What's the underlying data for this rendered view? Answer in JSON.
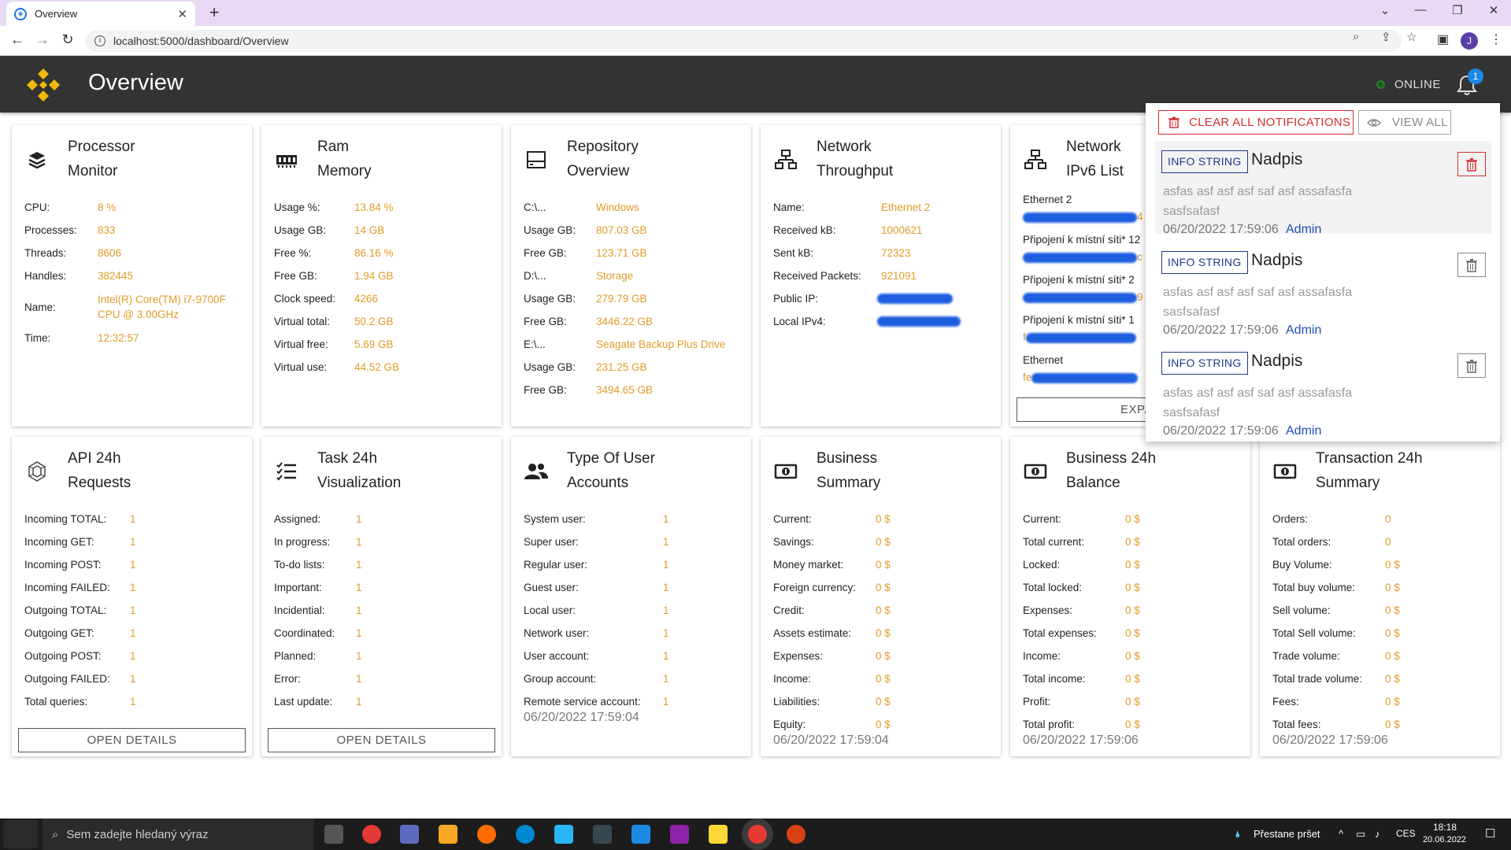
{
  "browser": {
    "tab_title": "Overview",
    "url": "localhost:5000/dashboard/Overview",
    "profile_initial": "J"
  },
  "header": {
    "title": "Overview",
    "status": "ONLINE",
    "notification_count": "1"
  },
  "cards_top": [
    {
      "title1": "Processor",
      "title2": "Monitor",
      "icon": "layers-icon",
      "rows": [
        {
          "k": "CPU:",
          "v": "8 %"
        },
        {
          "k": "Processes:",
          "v": "833"
        },
        {
          "k": "Threads:",
          "v": "8606"
        },
        {
          "k": "Handles:",
          "v": "382445"
        },
        {
          "k": "Name:",
          "v": "Intel(R) Core(TM) i7-9700F CPU @ 3.00GHz"
        },
        {
          "k": "Time:",
          "v": "12:32:57"
        }
      ]
    },
    {
      "title1": "Ram",
      "title2": "Memory",
      "icon": "memory-icon",
      "rows": [
        {
          "k": "Usage %:",
          "v": "13.84 %"
        },
        {
          "k": "Usage GB:",
          "v": "14 GB"
        },
        {
          "k": "Free %:",
          "v": "86.16 %"
        },
        {
          "k": "Free GB:",
          "v": "1.94 GB"
        },
        {
          "k": "Clock speed:",
          "v": "4266"
        },
        {
          "k": "Virtual total:",
          "v": "50.2 GB"
        },
        {
          "k": "Virtual free:",
          "v": "5.69 GB"
        },
        {
          "k": "Virtual use:",
          "v": "44.52 GB"
        }
      ]
    },
    {
      "title1": "Repository",
      "title2": "Overview",
      "icon": "storage-icon",
      "rows": [
        {
          "k": "C:\\...",
          "v": "Windows"
        },
        {
          "k": "Usage GB:",
          "v": "807.03 GB"
        },
        {
          "k": "Free GB:",
          "v": "123.71 GB"
        },
        {
          "k": "D:\\...",
          "v": "Storage"
        },
        {
          "k": "Usage GB:",
          "v": "279.79 GB"
        },
        {
          "k": "Free GB:",
          "v": "3446.22 GB"
        },
        {
          "k": "E:\\...",
          "v": "Seagate Backup Plus Drive"
        },
        {
          "k": "Usage GB:",
          "v": "231.25 GB"
        },
        {
          "k": "Free GB:",
          "v": "3494.65 GB"
        }
      ]
    },
    {
      "title1": "Network",
      "title2": "Throughput",
      "icon": "network-icon",
      "rows": [
        {
          "k": "Name:",
          "v": "Ethernet 2"
        },
        {
          "k": "Received kB:",
          "v": "1000621"
        },
        {
          "k": "Sent kB:",
          "v": "72323"
        },
        {
          "k": "Received Packets:",
          "v": "921091"
        },
        {
          "k": "Public IP:",
          "v": ""
        },
        {
          "k": "Local IPv4:",
          "v": ""
        }
      ]
    },
    {
      "title1": "Network",
      "title2": "IPv6 List",
      "icon": "network-icon",
      "entries": [
        {
          "name": "Ethernet 2",
          "tail": "4"
        },
        {
          "name": "Připojení k místní síti* 12",
          "tail": "c"
        },
        {
          "name": "Připojení k místní síti* 2",
          "tail": "9"
        },
        {
          "name": "Připojení k místní síti* 1",
          "tail": "f"
        },
        {
          "name": "Ethernet",
          "tail": "fe"
        }
      ],
      "button": "EXPAND I"
    }
  ],
  "cards_bottom": [
    {
      "title1": "API 24h",
      "title2": "Requests",
      "icon": "api-icon",
      "rows": [
        {
          "k": "Incoming TOTAL:",
          "v": "1"
        },
        {
          "k": "Incoming GET:",
          "v": "1"
        },
        {
          "k": "Incoming POST:",
          "v": "1"
        },
        {
          "k": "Incoming FAILED:",
          "v": "1"
        },
        {
          "k": "Outgoing TOTAL:",
          "v": "1"
        },
        {
          "k": "Outgoing GET:",
          "v": "1"
        },
        {
          "k": "Outgoing POST:",
          "v": "1"
        },
        {
          "k": "Outgoing FAILED:",
          "v": "1"
        },
        {
          "k": "Total queries:",
          "v": "1"
        }
      ],
      "button": "OPEN DETAILS"
    },
    {
      "title1": "Task 24h",
      "title2": "Visualization",
      "icon": "checklist-icon",
      "rows": [
        {
          "k": "Assigned:",
          "v": "1"
        },
        {
          "k": "In progress:",
          "v": "1"
        },
        {
          "k": "To-do lists:",
          "v": "1"
        },
        {
          "k": "Important:",
          "v": "1"
        },
        {
          "k": "Incidential:",
          "v": "1"
        },
        {
          "k": "Coordinated:",
          "v": "1"
        },
        {
          "k": "Planned:",
          "v": "1"
        },
        {
          "k": "Error:",
          "v": "1"
        },
        {
          "k": "Last update:",
          "v": "1"
        }
      ],
      "button": "OPEN DETAILS"
    },
    {
      "title1": "Type Of User",
      "title2": "Accounts",
      "icon": "users-icon",
      "rows": [
        {
          "k": "System user:",
          "v": "1"
        },
        {
          "k": "Super user:",
          "v": "1"
        },
        {
          "k": "Regular user:",
          "v": "1"
        },
        {
          "k": "Guest user:",
          "v": "1"
        },
        {
          "k": "Local user:",
          "v": "1"
        },
        {
          "k": "Network user:",
          "v": "1"
        },
        {
          "k": "User account:",
          "v": "1"
        },
        {
          "k": "Group account:",
          "v": "1"
        },
        {
          "k": "Remote service account:",
          "v": "1"
        }
      ],
      "timestamp": "06/20/2022 17:59:04"
    },
    {
      "title1": "Business",
      "title2": "Summary",
      "icon": "money-icon",
      "rows": [
        {
          "k": "Current:",
          "v": "0 $"
        },
        {
          "k": "Savings:",
          "v": "0 $"
        },
        {
          "k": "Money market:",
          "v": "0 $"
        },
        {
          "k": "Foreign currency:",
          "v": "0 $"
        },
        {
          "k": "Credit:",
          "v": "0 $"
        },
        {
          "k": "Assets estimate:",
          "v": "0 $"
        },
        {
          "k": "Expenses:",
          "v": "0 $"
        },
        {
          "k": "Income:",
          "v": "0 $"
        },
        {
          "k": "Liabilities:",
          "v": "0 $"
        },
        {
          "k": "Equity:",
          "v": "0 $"
        }
      ],
      "timestamp": "06/20/2022 17:59:04"
    },
    {
      "title1": "Business 24h",
      "title2": "Balance",
      "icon": "money-icon",
      "rows": [
        {
          "k": "Current:",
          "v": "0 $"
        },
        {
          "k": "Total current:",
          "v": "0 $"
        },
        {
          "k": "Locked:",
          "v": "0 $"
        },
        {
          "k": "Total locked:",
          "v": "0 $"
        },
        {
          "k": "Expenses:",
          "v": "0 $"
        },
        {
          "k": "Total expenses:",
          "v": "0 $"
        },
        {
          "k": "Income:",
          "v": "0 $"
        },
        {
          "k": "Total income:",
          "v": "0 $"
        },
        {
          "k": "Profit:",
          "v": "0 $"
        },
        {
          "k": "Total profit:",
          "v": "0 $"
        }
      ],
      "timestamp": "06/20/2022 17:59:06"
    },
    {
      "title1": "Transaction 24h",
      "title2": "Summary",
      "icon": "money-icon",
      "rows": [
        {
          "k": "Orders:",
          "v": "0"
        },
        {
          "k": "Total orders:",
          "v": "0"
        },
        {
          "k": "Buy Volume:",
          "v": "0 $"
        },
        {
          "k": "Total buy volume:",
          "v": "0 $"
        },
        {
          "k": "Sell volume:",
          "v": "0 $"
        },
        {
          "k": "Total Sell volume:",
          "v": "0 $"
        },
        {
          "k": "Trade volume:",
          "v": "0 $"
        },
        {
          "k": "Total trade volume:",
          "v": "0 $"
        },
        {
          "k": "Fees:",
          "v": "0 $"
        },
        {
          "k": "Total fees:",
          "v": "0 $"
        }
      ],
      "timestamp": "06/20/2022 17:59:06"
    }
  ],
  "notifications": {
    "clear_label": "CLEAR ALL NOTIFICATIONS",
    "view_label": "VIEW ALL",
    "items": [
      {
        "tag": "INFO STRING",
        "title": "Nadpis",
        "body": "asfas asf asf asf saf asf assafasfa sasfsafasf",
        "time": "06/20/2022 17:59:06",
        "author": "Admin"
      },
      {
        "tag": "INFO STRING",
        "title": "Nadpis",
        "body": "asfas asf asf asf saf asf assafasfa sasfsafasf",
        "time": "06/20/2022 17:59:06",
        "author": "Admin"
      },
      {
        "tag": "INFO STRING",
        "title": "Nadpis",
        "body": "asfas asf asf asf saf asf assafasfa sasfsafasf",
        "time": "06/20/2022 17:59:06",
        "author": "Admin"
      }
    ]
  },
  "taskbar": {
    "search_placeholder": "Sem zadejte hledaný výraz",
    "weather": "Přestane pršet",
    "lang": "CES",
    "time": "18:18",
    "date": "20.06.2022"
  },
  "colors": {
    "accent": "#e09c2a",
    "appbar": "#333333",
    "danger": "#d32f2f",
    "tag": "#1e3a8a"
  }
}
